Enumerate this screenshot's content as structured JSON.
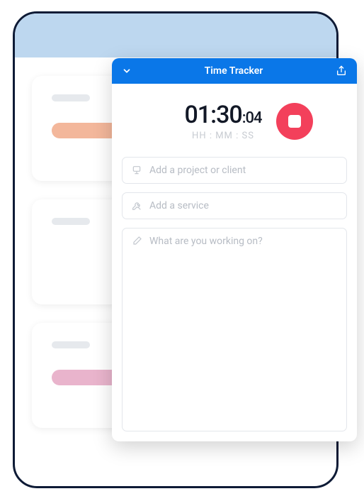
{
  "tracker": {
    "title": "Time Tracker",
    "timer": {
      "hhmm": "01:30",
      "ss": ":04",
      "hint": "HH : MM : SS"
    },
    "fields": {
      "project_placeholder": "Add a project or client",
      "service_placeholder": "Add a service",
      "note_placeholder": "What are you working on?"
    }
  }
}
